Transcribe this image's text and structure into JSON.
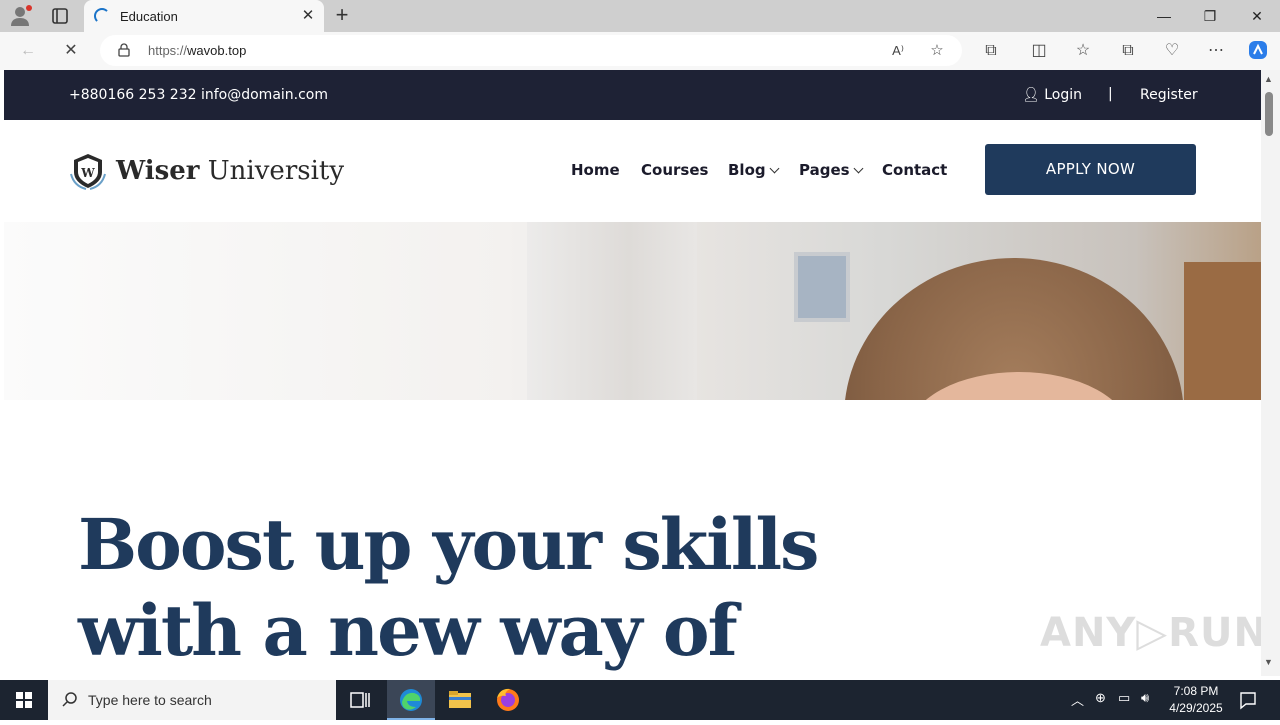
{
  "browser": {
    "tab_title": "Education",
    "tab_close": "✕",
    "new_tab": "+",
    "url_scheme": "https://",
    "url_host": "wavob.top",
    "window_controls": [
      "—",
      "❐",
      "✕"
    ]
  },
  "site": {
    "contact_line": "+880166 253 232 info@domain.com",
    "login": "Login",
    "separator": "|",
    "register": "Register",
    "brand_bold": "Wiser",
    "brand_light": " University",
    "nav": {
      "home": "Home",
      "courses": "Courses",
      "blog": "Blog",
      "pages": "Pages",
      "contact": "Contact"
    },
    "apply_button": "APPLY NOW",
    "headline_line1": "Boost up your skills",
    "headline_line2": "with a new way of"
  },
  "watermark": "ANY▷RUN",
  "taskbar": {
    "search_placeholder": "Type here to search",
    "time": "7:08 PM",
    "date": "4/29/2025"
  },
  "colors": {
    "topbar": "#1e2235",
    "accent": "#1f3a5c",
    "taskbar": "#1c2430"
  }
}
